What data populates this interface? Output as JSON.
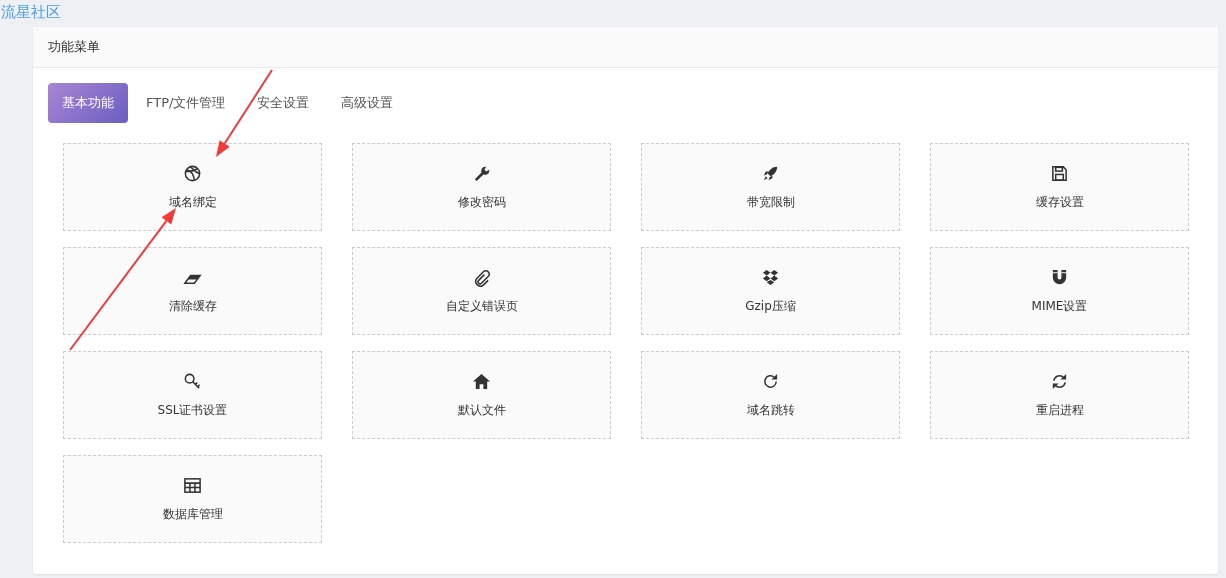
{
  "site_logo": "流星社区",
  "panel": {
    "title": "功能菜单"
  },
  "tabs": [
    {
      "label": "基本功能",
      "selected": true
    },
    {
      "label": "FTP/文件管理",
      "selected": false
    },
    {
      "label": "安全设置",
      "selected": false
    },
    {
      "label": "高级设置",
      "selected": false
    }
  ],
  "tiles": [
    {
      "label": "域名绑定"
    },
    {
      "label": "修改密码"
    },
    {
      "label": "带宽限制"
    },
    {
      "label": "缓存设置"
    },
    {
      "label": "清除缓存"
    },
    {
      "label": "自定义错误页"
    },
    {
      "label": "Gzip压缩"
    },
    {
      "label": "MIME设置"
    },
    {
      "label": "SSL证书设置"
    },
    {
      "label": "默认文件"
    },
    {
      "label": "域名跳转"
    },
    {
      "label": "重启进程"
    },
    {
      "label": "数据库管理"
    }
  ],
  "annotations": [
    {
      "kind": "arrow"
    },
    {
      "kind": "arrow"
    }
  ]
}
